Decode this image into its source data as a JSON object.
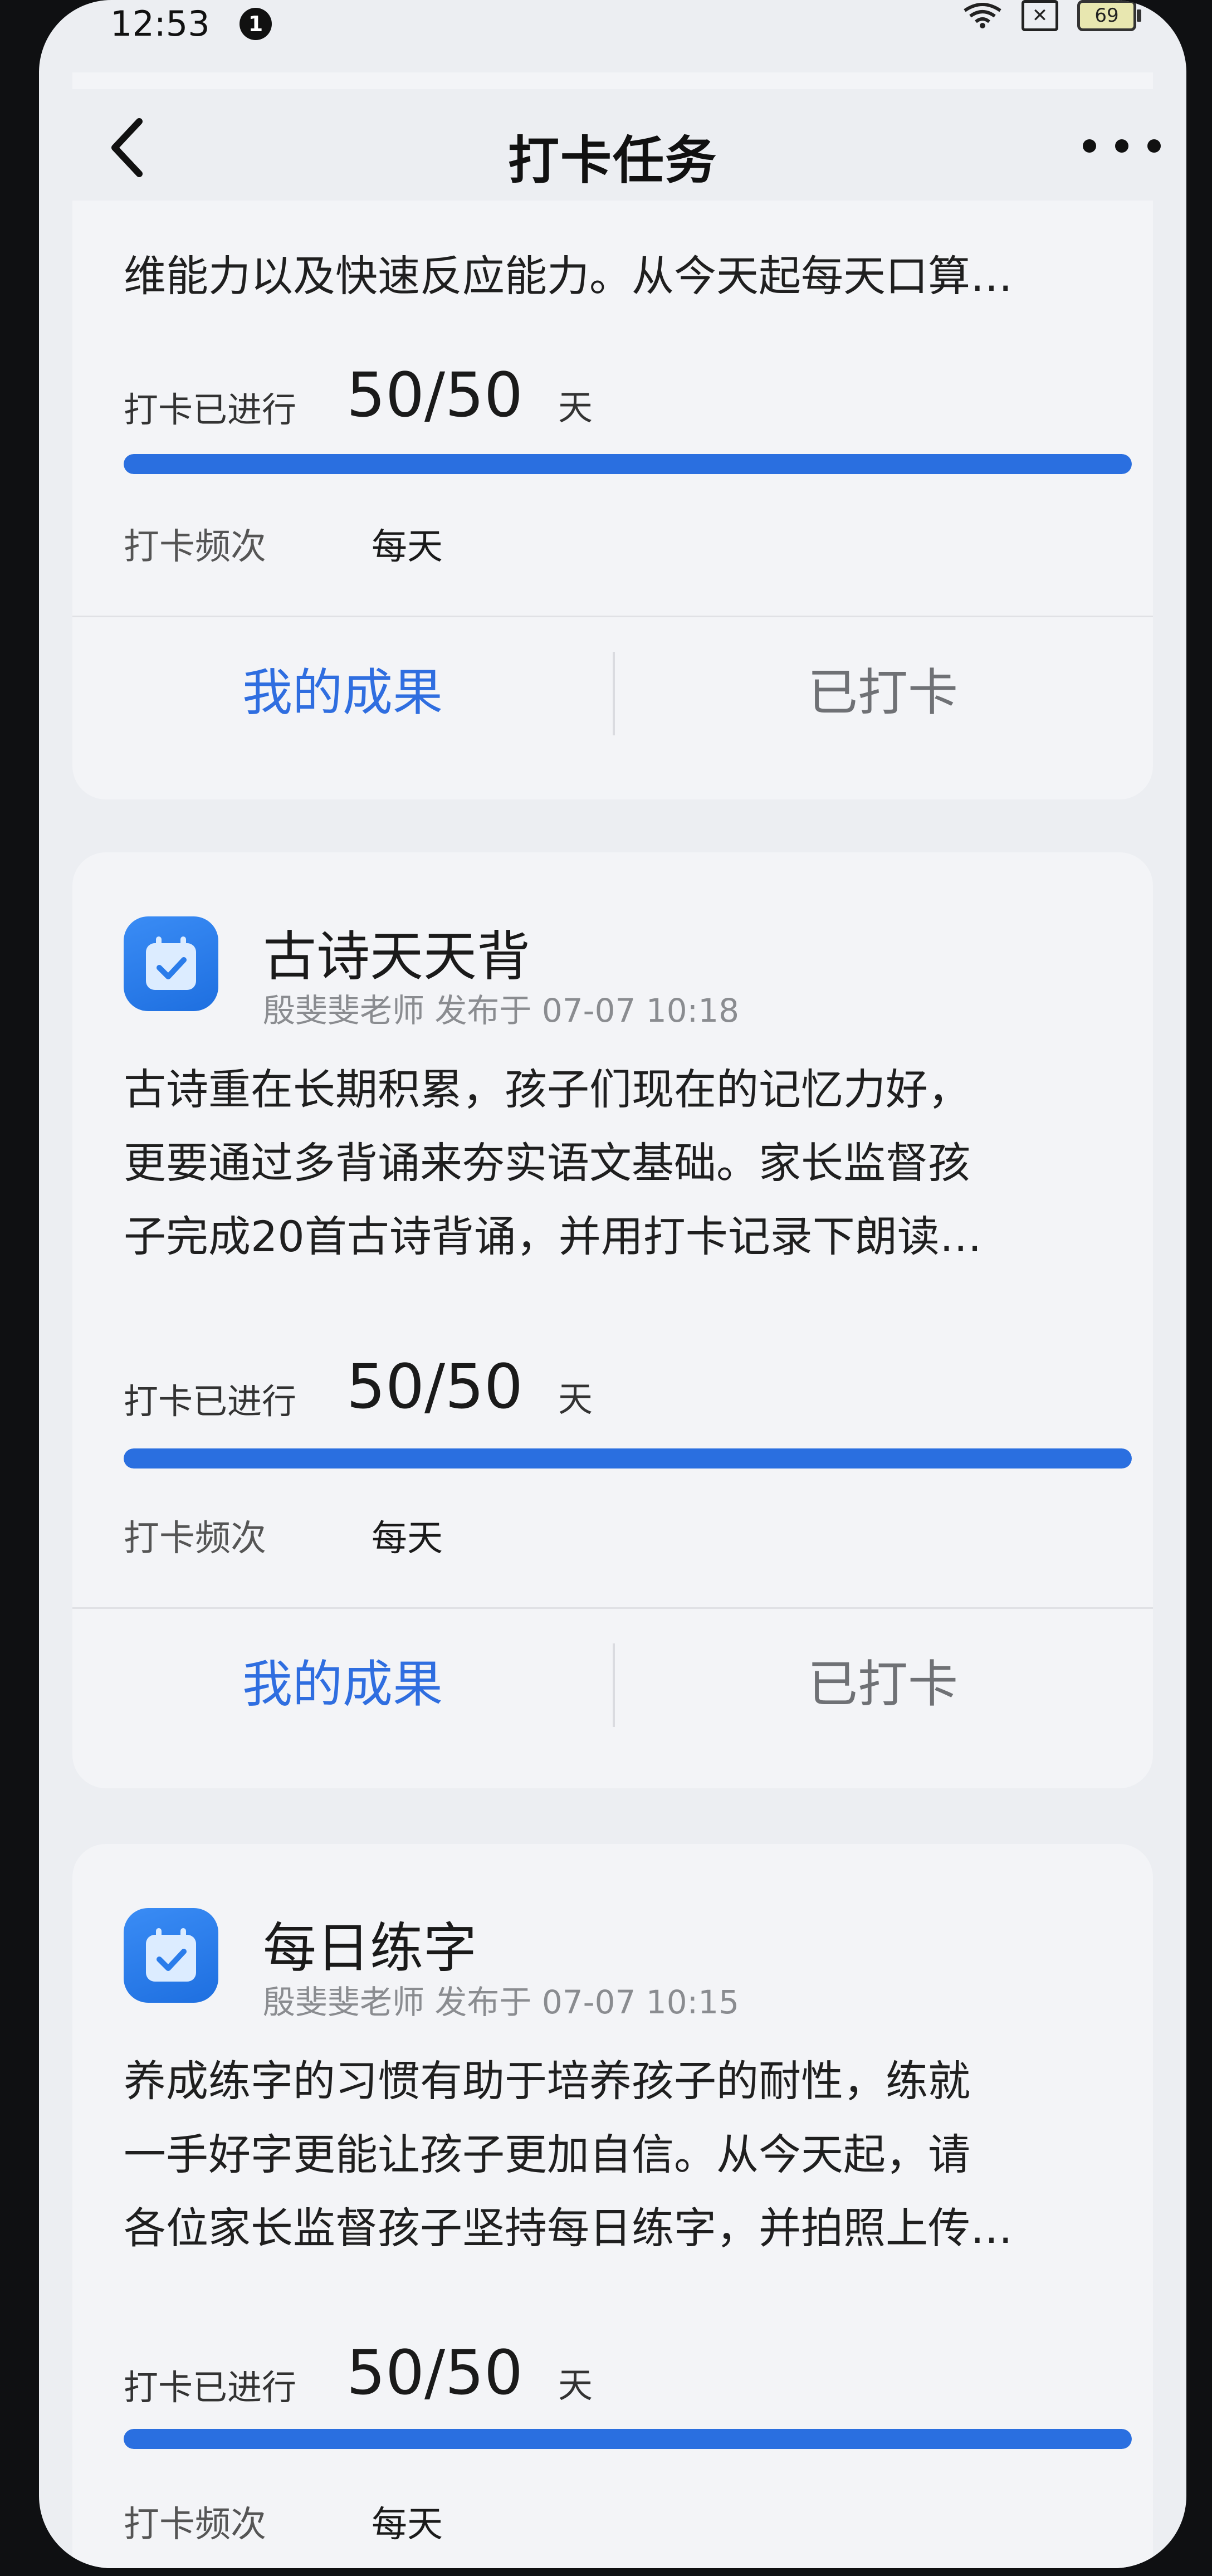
{
  "status_bar": {
    "time": "12:53",
    "notification_count": "1",
    "battery": "69"
  },
  "nav": {
    "title": "打卡任务"
  },
  "tasks": [
    {
      "description_lines": [
        "维能力以及快速反应能力。从今天起每天口算…"
      ],
      "progress_label": "打卡已进行",
      "progress": "50/50",
      "progress_fraction": 1.0,
      "progress_unit": "天",
      "frequency_label": "打卡频次",
      "frequency": "每天",
      "action_left": "我的成果",
      "action_right": "已打卡"
    },
    {
      "title": "古诗天天背",
      "meta": "殷斐斐老师 发布于 07-07 10:18",
      "description_lines": [
        "古诗重在长期积累，孩子们现在的记忆力好，",
        "更要通过多背诵来夯实语文基础。家长监督孩",
        "子完成20首古诗背诵，并用打卡记录下朗读…"
      ],
      "progress_label": "打卡已进行",
      "progress": "50/50",
      "progress_fraction": 1.0,
      "progress_unit": "天",
      "frequency_label": "打卡频次",
      "frequency": "每天",
      "action_left": "我的成果",
      "action_right": "已打卡"
    },
    {
      "title": "每日练字",
      "meta": "殷斐斐老师 发布于 07-07 10:15",
      "description_lines": [
        "养成练字的习惯有助于培养孩子的耐性，练就",
        "一手好字更能让孩子更加自信。从今天起，请",
        "各位家长监督孩子坚持每日练字，并拍照上传…"
      ],
      "progress_label": "打卡已进行",
      "progress": "50/50",
      "progress_fraction": 1.0,
      "progress_unit": "天",
      "frequency_label": "打卡频次",
      "frequency": "每天"
    }
  ],
  "colors": {
    "accent": "#2f6ee0",
    "progress_fill": "#2a6fe0",
    "icon_bg": "#2a7cea"
  }
}
